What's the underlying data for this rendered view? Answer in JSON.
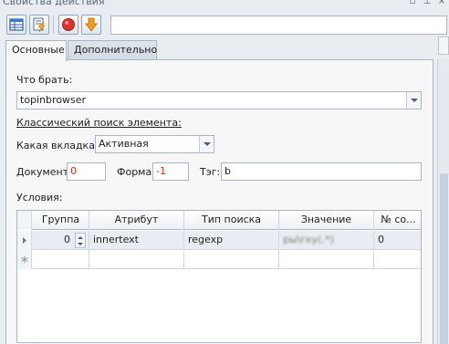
{
  "window": {
    "title": "Свойства действия"
  },
  "toolbar": {
    "buttons": [
      "grid-view",
      "edit-script",
      "stop",
      "download"
    ],
    "input_value": ""
  },
  "tabs": [
    {
      "label": "Основные",
      "active": true
    },
    {
      "label": "Дополнительно",
      "active": false
    }
  ],
  "form": {
    "what_label": "Что брать:",
    "what_value": "topinbrowser",
    "classic_search_label": "Классический поиск элемента:",
    "tab_label": "Какая вкладка:",
    "tab_value": "Активная",
    "document_label": "Документ:",
    "document_value": "0",
    "form_label": "Форма:",
    "form_value": "-1",
    "tag_label": "Тэг:",
    "tag_value": "b",
    "conditions_label": "Условия:"
  },
  "grid": {
    "columns": [
      "Группа",
      "Атрибут",
      "Тип поиска",
      "Значение",
      "№ со..."
    ],
    "rows": [
      {
        "group": "0",
        "attribute": "innertext",
        "search_type": "regexp",
        "value": "ры\\гку(.*)",
        "number": "0"
      }
    ]
  },
  "colors": {
    "background": "#e9edf2",
    "panel": "#f7f7f7",
    "border": "#a9b6c6",
    "accent_red": "#c0392b"
  }
}
